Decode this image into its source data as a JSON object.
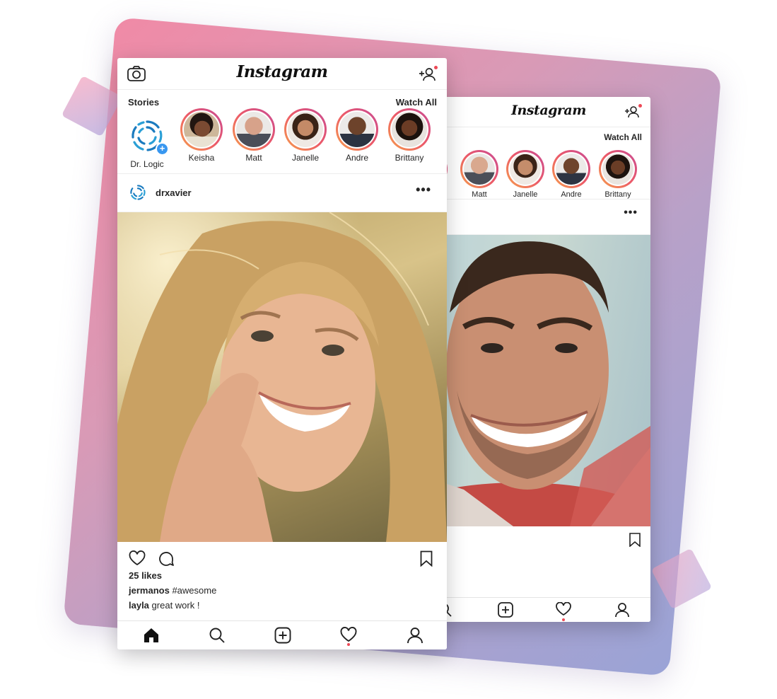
{
  "brand": {
    "name": "Instagram",
    "accent": "#ed4956",
    "story_ring_colors": [
      "#f6a04d",
      "#ec5a68",
      "#c84b95"
    ],
    "link_blue": "#3897f0"
  },
  "front": {
    "header": {
      "logo": "Instagram",
      "left_icon": "camera-icon",
      "right_icon": "add-user-icon"
    },
    "stories": {
      "title": "Stories",
      "watch_all": "Watch All",
      "items": [
        {
          "name": "Dr. Logic",
          "own": true
        },
        {
          "name": "Keisha"
        },
        {
          "name": "Matt"
        },
        {
          "name": "Janelle"
        },
        {
          "name": "Andre"
        },
        {
          "name": "Brittany"
        }
      ]
    },
    "post": {
      "username": "drxavier",
      "more": "•••",
      "likes": "25 likes",
      "comments": [
        {
          "user": "jermanos",
          "text": "#awesome"
        },
        {
          "user": "layla",
          "text": "great work !"
        }
      ]
    },
    "tabbar": [
      "home-icon",
      "search-icon",
      "add-post-icon",
      "heart-icon",
      "profile-icon"
    ]
  },
  "back": {
    "header": {
      "logo": "Instagram",
      "right_icon": "add-user-icon"
    },
    "stories": {
      "watch_all": "Watch All",
      "items": [
        {
          "name": "Matt"
        },
        {
          "name": "Janelle"
        },
        {
          "name": "Andre"
        },
        {
          "name": "Brittany"
        }
      ]
    },
    "post": {
      "more": "•••"
    },
    "tabbar": [
      "search-icon",
      "add-post-icon",
      "heart-icon",
      "profile-icon"
    ]
  }
}
